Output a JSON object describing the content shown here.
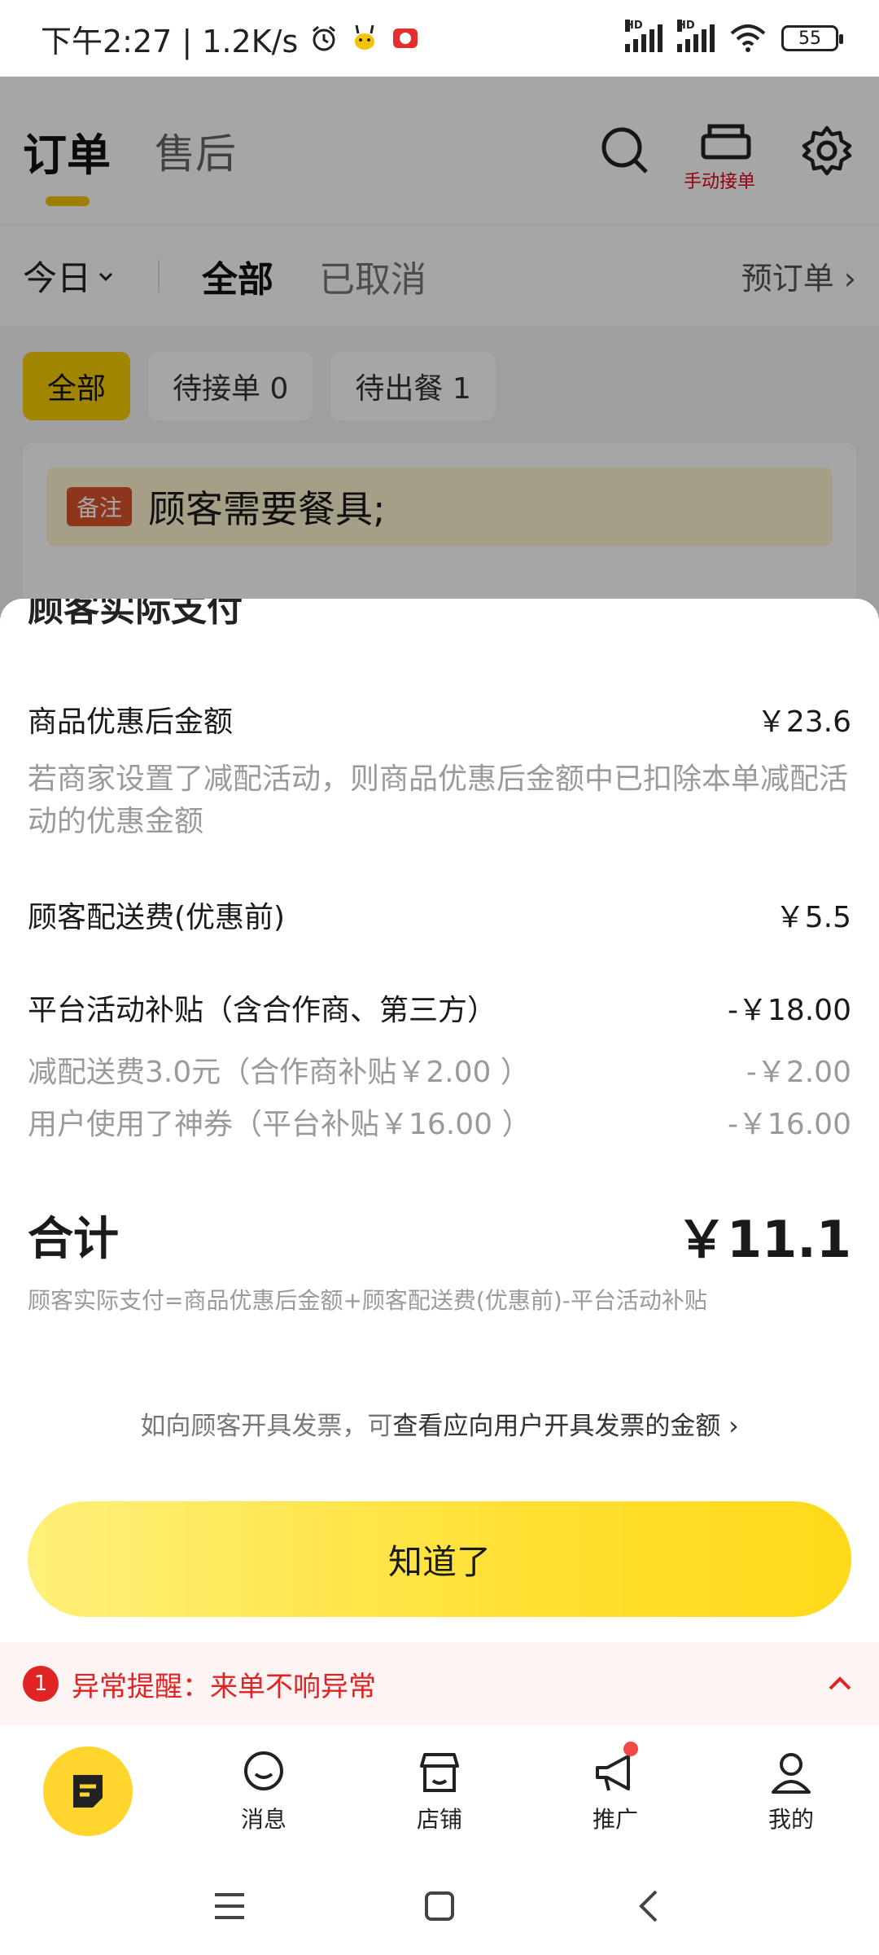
{
  "status_bar": {
    "time": "下午2:27 | 1.2K/s",
    "signal_label": "HD",
    "battery": "55"
  },
  "background": {
    "nav_tabs": [
      "订单",
      "售后"
    ],
    "manual_accept": "手动接单",
    "filters": {
      "today": "今日",
      "all": "全部",
      "cancelled": "已取消",
      "preorder": "预订单 ›"
    },
    "chips": [
      "全部",
      "待接单 0",
      "待出餐 1"
    ],
    "note_tag": "备注",
    "note_text": "顾客需要餐具;"
  },
  "sheet": {
    "cut_title": "顾客实际支付",
    "goods_label": "商品优惠后金额",
    "goods_value": "￥23.6",
    "goods_hint": "若商家设置了减配活动，则商品优惠后金额中已扣除本单减配活动的优惠金额",
    "delivery_label": "顾客配送费(优惠前)",
    "delivery_value": "￥5.5",
    "subsidy_label": "平台活动补贴（含合作商、第三方）",
    "subsidy_value": "-￥18.00",
    "sub1_label": "减配送费3.0元（合作商补贴￥2.00 ）",
    "sub1_value": "-￥2.00",
    "sub2_label": "用户使用了神券（平台补贴￥16.00 ）",
    "sub2_value": "-￥16.00",
    "total_label": "合计",
    "total_value": "￥11.1",
    "formula": "顾客实际支付=商品优惠后金额+顾客配送费(优惠前)-平台活动补贴",
    "invoice_prefix": "如向顾客开具发票，可",
    "invoice_link": "查看应向用户开具发票的金额 ›",
    "ok_button": "知道了"
  },
  "alert": {
    "count": "1",
    "text": "异常提醒：来单不响异常"
  },
  "tab_bar": {
    "messages": "消息",
    "store": "店铺",
    "promote": "推广",
    "mine": "我的"
  }
}
